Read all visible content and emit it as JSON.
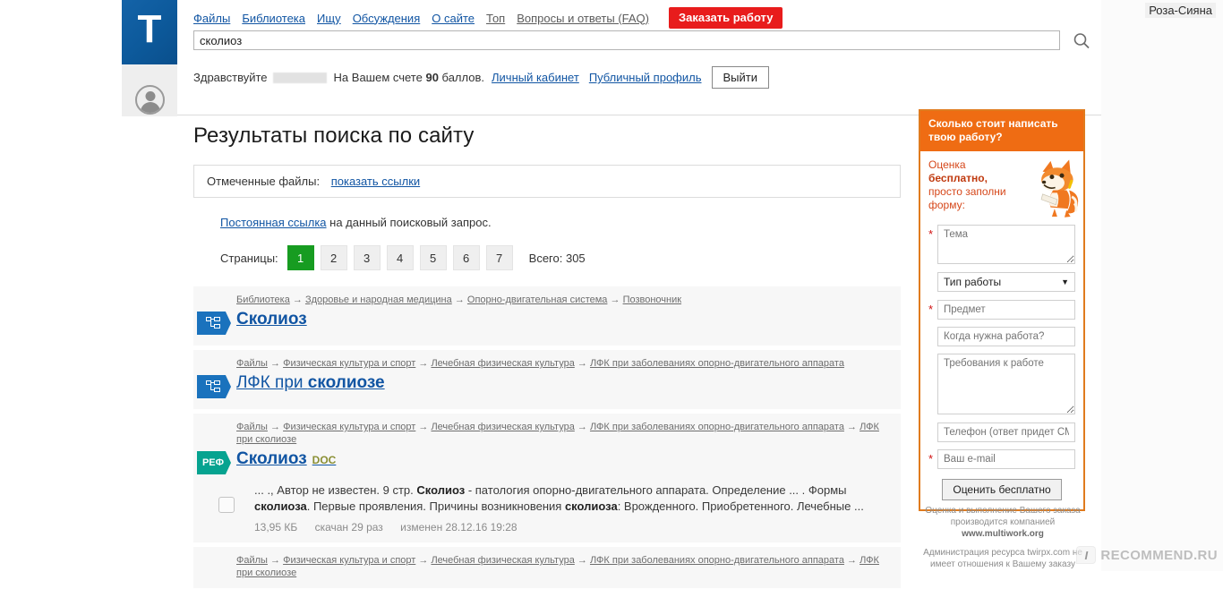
{
  "user_chip": "Роза-Сияна",
  "logo": {
    "letter": "T"
  },
  "nav": {
    "items": [
      {
        "label": "Файлы",
        "muted": false
      },
      {
        "label": "Библиотека",
        "muted": false
      },
      {
        "label": "Ищу",
        "muted": false
      },
      {
        "label": "Обсуждения",
        "muted": false
      },
      {
        "label": "О сайте",
        "muted": false
      },
      {
        "label": "Топ",
        "muted": true
      },
      {
        "label": "Вопросы и ответы (FAQ)",
        "muted": true
      }
    ],
    "order_button": "Заказать работу"
  },
  "search": {
    "value": "сколиоз",
    "placeholder": "",
    "icon": "search-icon"
  },
  "greeting": {
    "hello": "Здравствуйте",
    "balance_prefix": "На Вашем счете ",
    "balance_points": "90",
    "balance_suffix": " баллов.",
    "account_link": "Личный кабинет",
    "profile_link": "Публичный профиль",
    "logout": "Выйти"
  },
  "main": {
    "title": "Результаты поиска по сайту",
    "marked_files_label": "Отмеченные файлы:",
    "marked_files_link": "показать ссылки",
    "permalink_link": "Постоянная ссылка",
    "permalink_rest": " на данный поисковый запрос.",
    "pager_label": "Страницы:",
    "pages": [
      "1",
      "2",
      "3",
      "4",
      "5",
      "6",
      "7"
    ],
    "active_page": "1",
    "total_label": "Всего: 305"
  },
  "results": [
    {
      "badge_type": "lib",
      "badge_text": "",
      "crumbs": [
        "Библиотека",
        "Здоровье и народная медицина",
        "Опорно-двигательная система",
        "Позвоночник"
      ],
      "title_plain": "",
      "title_bold": "Сколиоз",
      "ext": "",
      "snippet": "",
      "snippet_bold": [],
      "size": "",
      "downloads": "",
      "modified": ""
    },
    {
      "badge_type": "lib",
      "badge_text": "",
      "crumbs": [
        "Файлы",
        "Физическая культура и спорт",
        "Лечебная физическая культура",
        "ЛФК при заболеваниях опорно-двигательного аппарата"
      ],
      "title_plain": "ЛФК при ",
      "title_bold": "сколиозе",
      "ext": "",
      "snippet": "",
      "snippet_bold": [],
      "size": "",
      "downloads": "",
      "modified": ""
    },
    {
      "badge_type": "ref",
      "badge_text": "РЕФ",
      "crumbs": [
        "Файлы",
        "Физическая культура и спорт",
        "Лечебная физическая культура",
        "ЛФК при заболеваниях опорно-двигательного аппарата",
        "ЛФК при сколиозе"
      ],
      "title_plain": "",
      "title_bold": "Сколиоз",
      "ext": "DOC",
      "snippet_parts": [
        {
          "t": "... ., Автор не известен. 9 стр. ",
          "b": false
        },
        {
          "t": "Сколиоз",
          "b": true
        },
        {
          "t": " - патология опорно-двигательного аппарата. Определение ... . Формы ",
          "b": false
        },
        {
          "t": "сколиоза",
          "b": true
        },
        {
          "t": ". Первые проявления. Причины возникновения ",
          "b": false
        },
        {
          "t": "сколиоза",
          "b": true
        },
        {
          "t": ": Врожденного. Приобретенного. Лечебные ...",
          "b": false
        }
      ],
      "size": "13,95 КБ",
      "downloads": "скачан 29 раз",
      "modified": "изменен 28.12.16 19:28"
    },
    {
      "badge_type": "lib",
      "badge_text": "",
      "crumbs": [
        "Файлы",
        "Физическая культура и спорт",
        "Лечебная физическая культура",
        "ЛФК при заболеваниях опорно-двигательного аппарата",
        "ЛФК при сколиозе"
      ],
      "title_plain": "",
      "title_bold": "",
      "ext": "",
      "snippet": "",
      "snippet_bold": [],
      "size": "",
      "downloads": "",
      "modified": ""
    }
  ],
  "promo": {
    "header": "Сколько стоит написать твою работу?",
    "pitch_1": "Оценка",
    "pitch_2": "бесплатно,",
    "pitch_3": "просто заполни",
    "pitch_4": "форму:",
    "fields": {
      "theme_placeholder": "Тема",
      "worktype_selected": "Тип работы",
      "subject_placeholder": "Предмет",
      "when_placeholder": "Когда нужна работа?",
      "requirements_placeholder": "Требования к работе",
      "phone_placeholder": "Телефон (ответ придет СМС)",
      "email_placeholder": "Ваш e-mail"
    },
    "submit": "Оценить бесплатно",
    "footnote_1a": "Оценка и выполнение Вашего заказа",
    "footnote_1b": "производится компанией",
    "footnote_site": "www.multiwork.org",
    "footnote_2a": "Администрация ресурса twirpx.com не",
    "footnote_2b": "имеет отношения к Вашему заказу"
  },
  "watermark": {
    "mark": "I",
    "text": "RECOMMEND.RU"
  },
  "colors": {
    "brand_blue": "#1155a3",
    "logo_blue": "#0d5a9c",
    "order_red": "#e81c1c",
    "pager_green": "#179c21",
    "promo_orange": "#ef6c13",
    "promo_border": "#e07b1e",
    "promo_text_red": "#d6471a",
    "ref_badge_teal": "#06a390",
    "lib_badge_blue": "#1a72bd",
    "ext_olive": "#8a8f33",
    "result_bg": "#f7f7f7"
  }
}
